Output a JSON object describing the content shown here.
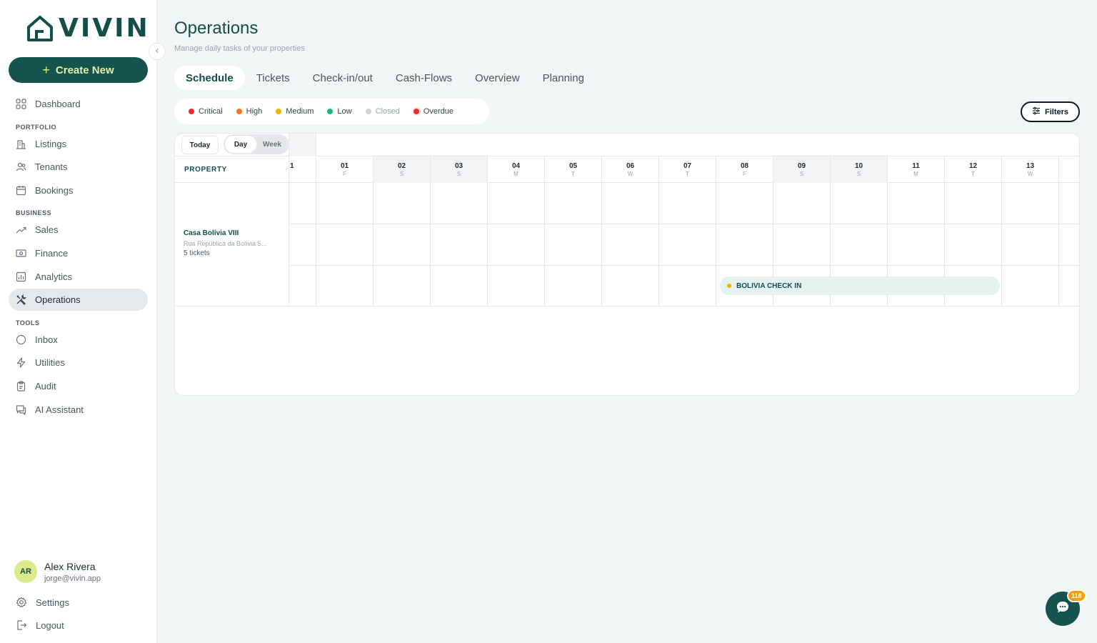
{
  "brand": {
    "name": "VIVIN",
    "primary": "#14534e",
    "accent": "#d9ef8f"
  },
  "sidebar": {
    "create_label": "Create New",
    "items": [
      {
        "label": "Dashboard",
        "icon": "grid-icon"
      },
      {
        "label": "Listings",
        "icon": "building-icon"
      },
      {
        "label": "Tenants",
        "icon": "users-icon"
      },
      {
        "label": "Bookings",
        "icon": "calendar-icon"
      },
      {
        "label": "Sales",
        "icon": "trend-icon"
      },
      {
        "label": "Finance",
        "icon": "money-icon"
      },
      {
        "label": "Analytics",
        "icon": "chart-icon"
      },
      {
        "label": "Operations",
        "icon": "tools-icon"
      },
      {
        "label": "Inbox",
        "icon": "message-icon"
      },
      {
        "label": "Utilities",
        "icon": "bolt-icon"
      },
      {
        "label": "Audit",
        "icon": "clipboard-icon"
      },
      {
        "label": "AI Assistant",
        "icon": "chat-icon"
      }
    ],
    "sections": {
      "portfolio": "PORTFOLIO",
      "business": "BUSINESS",
      "tools": "TOOLS"
    },
    "active": "Operations",
    "user": {
      "initials": "AR",
      "name": "Alex Rivera",
      "email": "jorge@vivin.app"
    },
    "settings_label": "Settings",
    "logout_label": "Logout"
  },
  "page": {
    "title": "Operations",
    "subtitle": "Manage daily tasks of your properties"
  },
  "tabs": [
    {
      "label": "Schedule",
      "active": true
    },
    {
      "label": "Tickets"
    },
    {
      "label": "Check-in/out"
    },
    {
      "label": "Cash-Flows"
    },
    {
      "label": "Overview"
    },
    {
      "label": "Planning"
    }
  ],
  "legend": [
    {
      "label": "Critical",
      "color": "#ef2b2b"
    },
    {
      "label": "High",
      "color": "#f97316"
    },
    {
      "label": "Medium",
      "color": "#f5b400"
    },
    {
      "label": "Low",
      "color": "#10b981"
    },
    {
      "label": "Closed",
      "color": "#d1d5db"
    },
    {
      "label": "Overdue",
      "color": "#ef2b2b"
    }
  ],
  "filters_label": "Filters",
  "schedule": {
    "today_label": "Today",
    "view_day": "Day",
    "view_week": "Week",
    "property_header": "PROPERTY",
    "partial_day": "1",
    "days": [
      {
        "num": "01",
        "letter": "F",
        "weekend": false
      },
      {
        "num": "02",
        "letter": "S",
        "weekend": true
      },
      {
        "num": "03",
        "letter": "S",
        "weekend": true
      },
      {
        "num": "04",
        "letter": "M",
        "weekend": false
      },
      {
        "num": "05",
        "letter": "T",
        "weekend": false
      },
      {
        "num": "06",
        "letter": "W",
        "weekend": false
      },
      {
        "num": "07",
        "letter": "T",
        "weekend": false
      },
      {
        "num": "08",
        "letter": "F",
        "weekend": false
      },
      {
        "num": "09",
        "letter": "S",
        "weekend": true
      },
      {
        "num": "10",
        "letter": "S",
        "weekend": true
      },
      {
        "num": "11",
        "letter": "M",
        "weekend": false
      },
      {
        "num": "12",
        "letter": "T",
        "weekend": false
      },
      {
        "num": "13",
        "letter": "W",
        "weekend": false
      }
    ],
    "property": {
      "name": "Casa Bolívia VIII",
      "address": "Rua República da Bolívia 5...",
      "tickets": "5 tickets"
    },
    "event": {
      "label": "BOLIVIA CHECK IN",
      "color": "#f5b400"
    }
  },
  "chat": {
    "badge": "118"
  }
}
